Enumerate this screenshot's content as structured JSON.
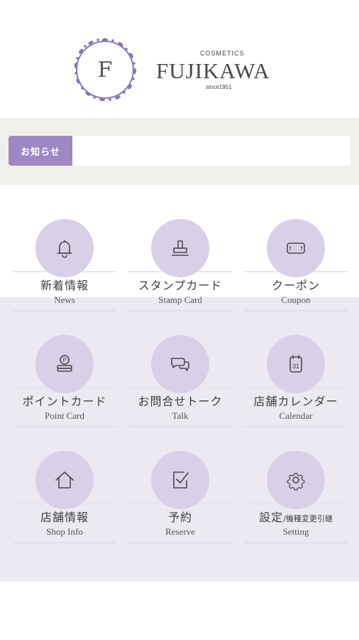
{
  "logo": {
    "emblem_letter": "F",
    "cosmetics": "COSMETICS",
    "name": "FUJIKAWA",
    "since": "since1951",
    "accent_color": "#9d88c3"
  },
  "news": {
    "label": "お知らせ",
    "text": ""
  },
  "menu": [
    {
      "jp": "新着情報",
      "en": "News",
      "icon": "bell-icon"
    },
    {
      "jp": "スタンプカード",
      "en": "Stamp Card",
      "icon": "stamp-icon"
    },
    {
      "jp": "クーポン",
      "en": "Coupon",
      "icon": "coupon-icon"
    },
    {
      "jp": "ポイントカード",
      "en": "Point Card",
      "icon": "coins-icon"
    },
    {
      "jp": "お問合せトーク",
      "en": "Talk",
      "icon": "chat-bubbles-icon"
    },
    {
      "jp": "店舗カレンダー",
      "en": "Calendar",
      "icon": "calendar-icon"
    },
    {
      "jp": "店舗情報",
      "en": "Shop Info",
      "icon": "home-icon"
    },
    {
      "jp": "予約",
      "en": "Reserve",
      "icon": "checkbox-icon"
    },
    {
      "jp": "設定",
      "jp_small": "/機種変更引継",
      "en": "Setting",
      "icon": "gear-icon"
    }
  ],
  "calendar_icon_text": "31"
}
